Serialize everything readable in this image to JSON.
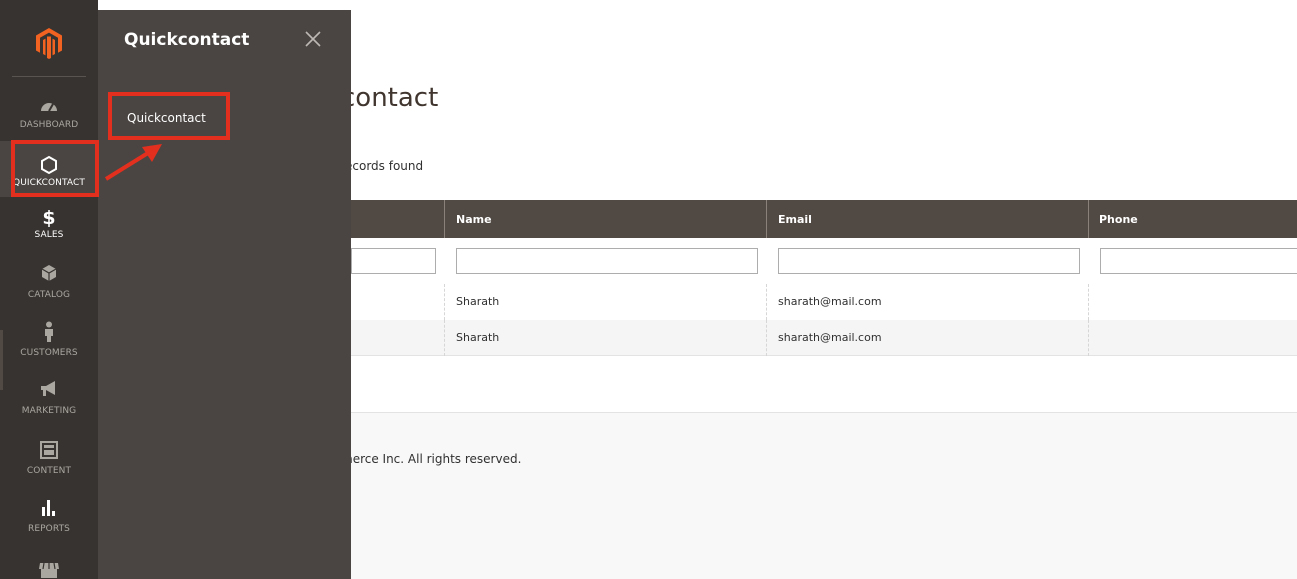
{
  "sidebar": {
    "items": [
      {
        "label": "DASHBOARD",
        "icon": "dashboard-icon"
      },
      {
        "label": "QUICKCONTACT",
        "icon": "hexagon-icon"
      },
      {
        "label": "SALES",
        "icon": "dollar-icon"
      },
      {
        "label": "CATALOG",
        "icon": "box-icon"
      },
      {
        "label": "CUSTOMERS",
        "icon": "person-icon"
      },
      {
        "label": "MARKETING",
        "icon": "megaphone-icon"
      },
      {
        "label": "CONTENT",
        "icon": "layout-icon"
      },
      {
        "label": "REPORTS",
        "icon": "bar-chart-icon"
      }
    ]
  },
  "flyout": {
    "title": "Quickcontact",
    "items": [
      {
        "label": "Quickcontact"
      }
    ]
  },
  "main": {
    "title_visible": "contact",
    "records_visible": "ecords found",
    "columns": [
      "Name",
      "Email",
      "Phone"
    ],
    "rows": [
      {
        "name": "Sharath",
        "email": "sharath@mail.com",
        "phone": ""
      },
      {
        "name": "Sharath",
        "email": "sharath@mail.com",
        "phone": ""
      }
    ],
    "footer_visible": "merce Inc. All rights reserved."
  },
  "colors": {
    "sidebar_bg": "#373330",
    "flyout_bg": "#4a4542",
    "grid_header_bg": "#514943",
    "highlight": "#e3301e",
    "logo": "#f26322"
  }
}
